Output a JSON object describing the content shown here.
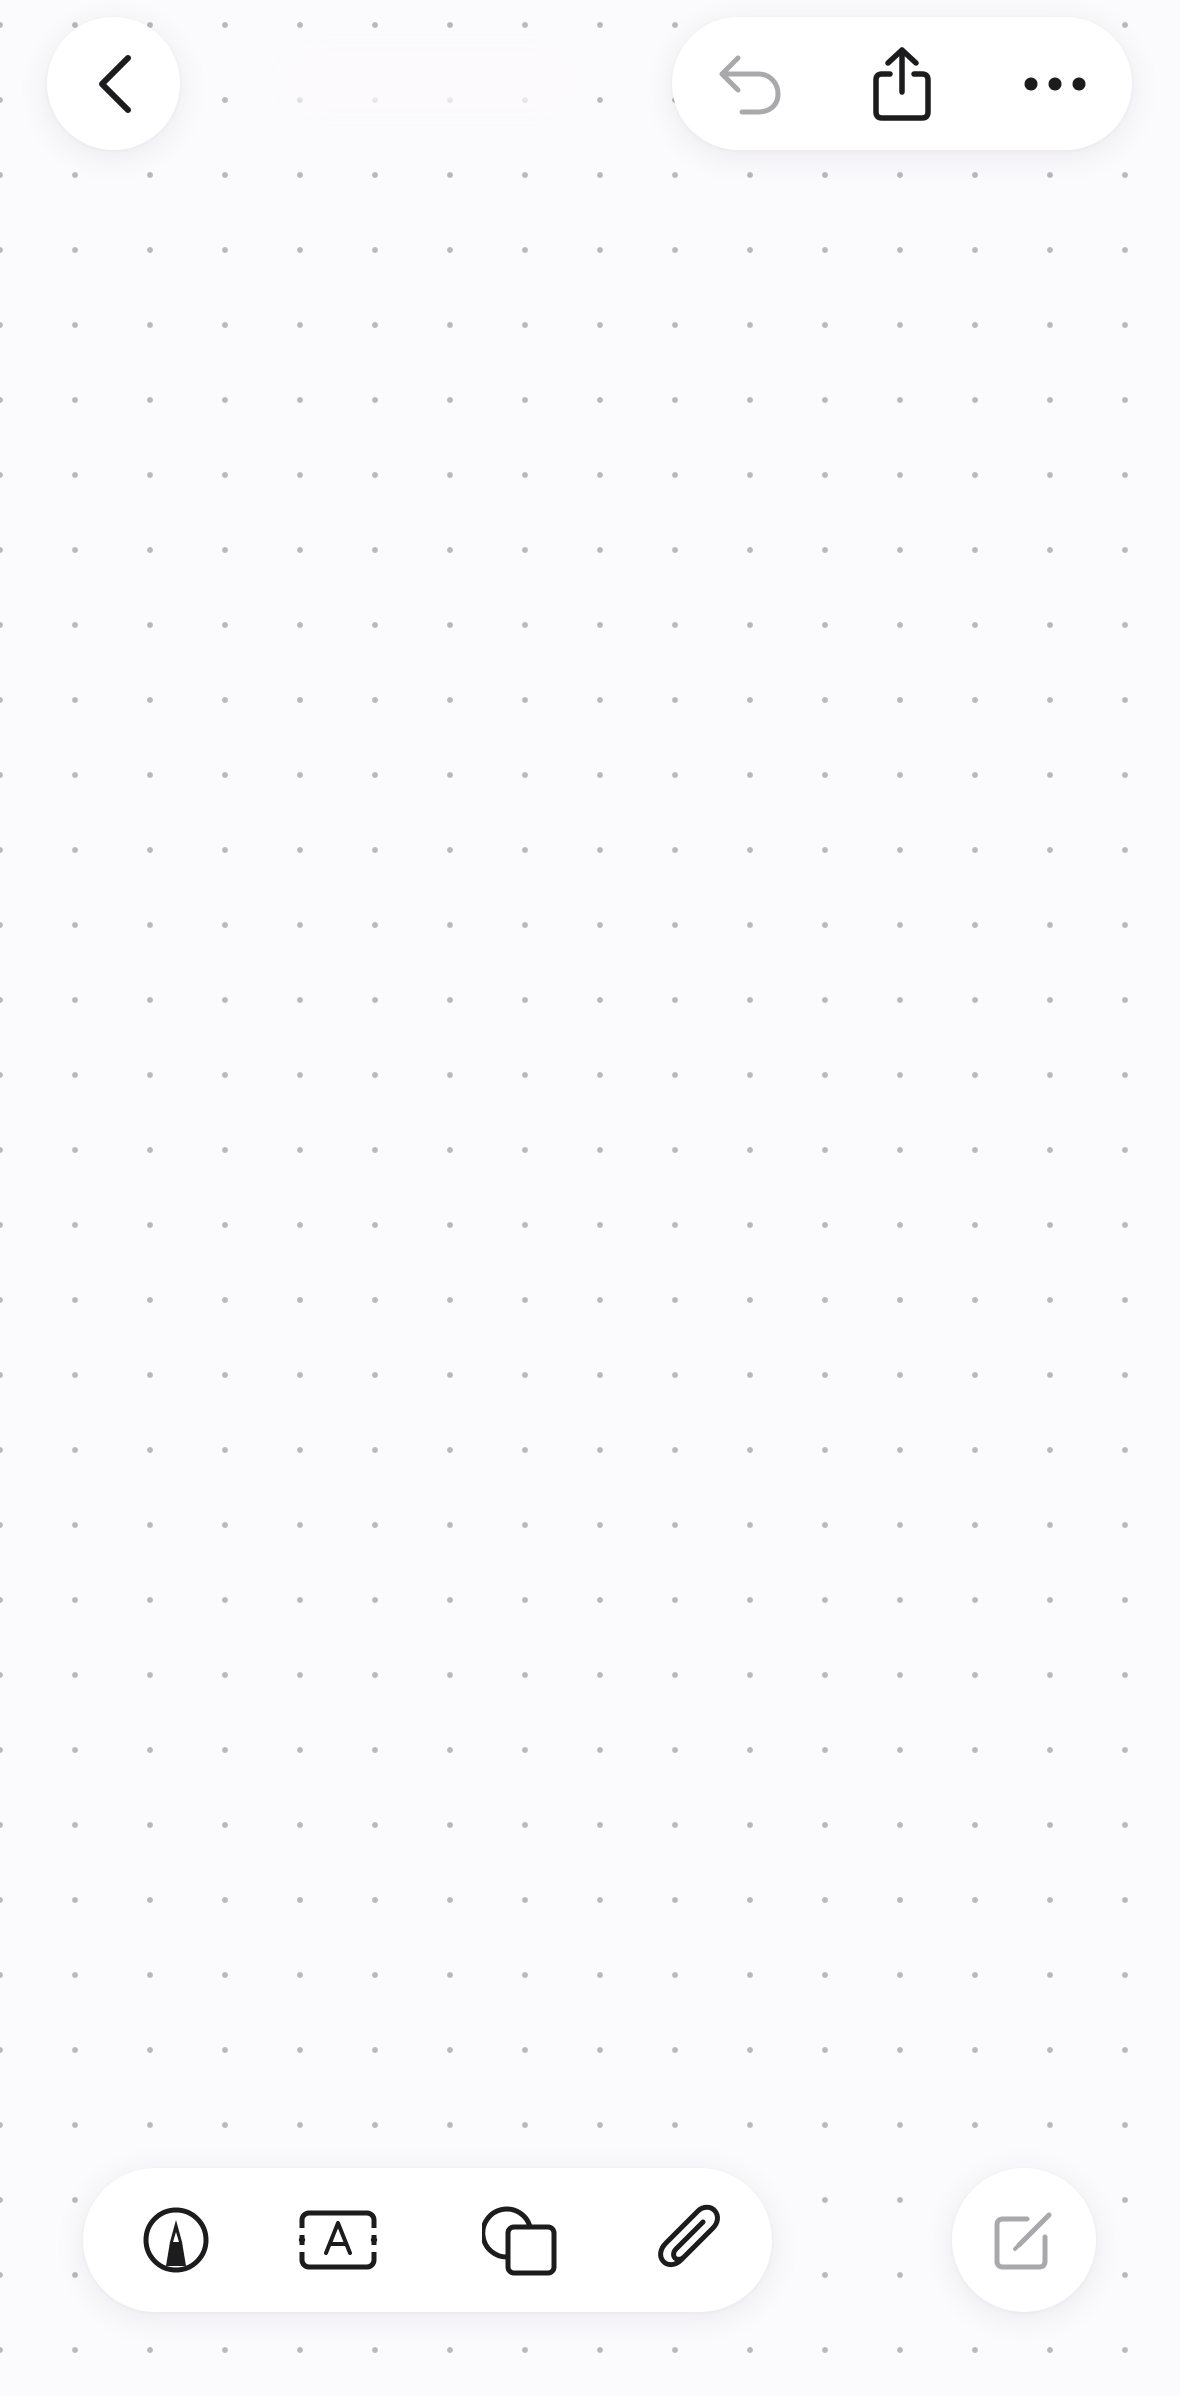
{
  "navigation": {
    "back_icon": "chevron-left-icon",
    "title": ""
  },
  "top_toolbar": {
    "undo_icon": "undo-arrow-icon",
    "share_icon": "share-icon",
    "more_icon": "ellipsis-icon"
  },
  "bottom_toolbar": {
    "tools": [
      {
        "id": "pen",
        "icon": "pen-tool-icon"
      },
      {
        "id": "text",
        "icon": "text-box-icon"
      },
      {
        "id": "shapes",
        "icon": "shapes-icon"
      },
      {
        "id": "attach",
        "icon": "paperclip-icon"
      }
    ]
  },
  "floating_action": {
    "icon": "compose-icon"
  },
  "colors": {
    "canvas_background": "#fbfafc",
    "grid_dot": "#b9b8bd",
    "icon_active": "#1c1c1e",
    "icon_disabled": "#a9a9ad",
    "panel": "#ffffff"
  }
}
